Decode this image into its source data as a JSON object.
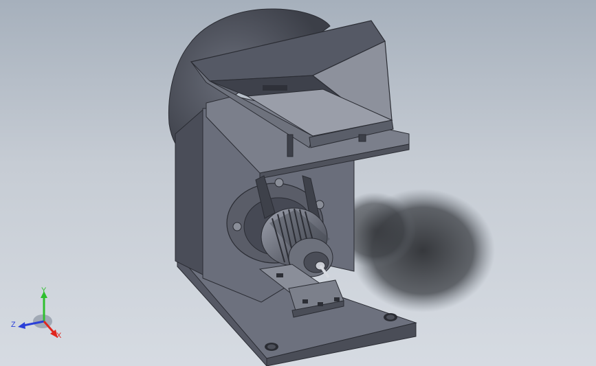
{
  "viewport": {
    "background_top": "#a6b0bc",
    "background_bottom": "#d6dbe2",
    "model_color": "#5e6270"
  },
  "triad": {
    "x_label": "X",
    "y_label": "Y",
    "z_label": "Z",
    "x_color": "#e0261e",
    "y_color": "#2fbf2f",
    "z_color": "#2a3fd8"
  }
}
